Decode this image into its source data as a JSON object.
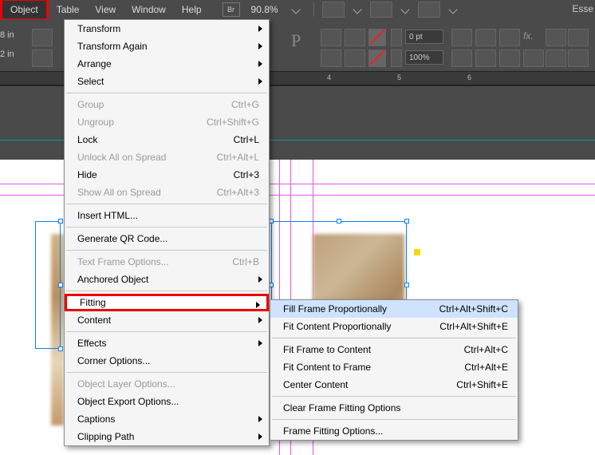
{
  "menubar": {
    "items": [
      "Object",
      "Table",
      "View",
      "Window",
      "Help"
    ],
    "active_index": 0,
    "br_label": "Br",
    "zoom": "90.8%"
  },
  "right_label": "Esse",
  "left_readouts": {
    "top": "8 in",
    "bottom": "2 in"
  },
  "toolbar2": {
    "pt_field": "0 pt",
    "pct_field": "100%"
  },
  "ruler_marks": [
    "4",
    "5",
    "6"
  ],
  "object_menu": [
    {
      "label": "Transform",
      "submenu": true
    },
    {
      "label": "Transform Again",
      "submenu": true
    },
    {
      "label": "Arrange",
      "submenu": true
    },
    {
      "label": "Select",
      "submenu": true
    },
    {
      "sep": true
    },
    {
      "label": "Group",
      "shortcut": "Ctrl+G",
      "disabled": true
    },
    {
      "label": "Ungroup",
      "shortcut": "Ctrl+Shift+G",
      "disabled": true
    },
    {
      "label": "Lock",
      "shortcut": "Ctrl+L"
    },
    {
      "label": "Unlock All on Spread",
      "shortcut": "Ctrl+Alt+L",
      "disabled": true
    },
    {
      "label": "Hide",
      "shortcut": "Ctrl+3"
    },
    {
      "label": "Show All on Spread",
      "shortcut": "Ctrl+Alt+3",
      "disabled": true
    },
    {
      "sep": true
    },
    {
      "label": "Insert HTML..."
    },
    {
      "sep": true
    },
    {
      "label": "Generate QR Code..."
    },
    {
      "sep": true
    },
    {
      "label": "Text Frame Options...",
      "shortcut": "Ctrl+B",
      "disabled": true
    },
    {
      "label": "Anchored Object",
      "submenu": true
    },
    {
      "sep": true
    },
    {
      "label": "Fitting",
      "submenu": true,
      "highlight": true,
      "boxed": true
    },
    {
      "label": "Content",
      "submenu": true
    },
    {
      "sep": true
    },
    {
      "label": "Effects",
      "submenu": true
    },
    {
      "label": "Corner Options..."
    },
    {
      "sep": true
    },
    {
      "label": "Object Layer Options...",
      "disabled": true
    },
    {
      "label": "Object Export Options..."
    },
    {
      "label": "Captions",
      "submenu": true
    },
    {
      "label": "Clipping Path",
      "submenu": true
    }
  ],
  "fitting_submenu": [
    {
      "label": "Fill Frame Proportionally",
      "shortcut": "Ctrl+Alt+Shift+C",
      "selected": true
    },
    {
      "label": "Fit Content Proportionally",
      "shortcut": "Ctrl+Alt+Shift+E"
    },
    {
      "sep": true
    },
    {
      "label": "Fit Frame to Content",
      "shortcut": "Ctrl+Alt+C"
    },
    {
      "label": "Fit Content to Frame",
      "shortcut": "Ctrl+Alt+E"
    },
    {
      "label": "Center Content",
      "shortcut": "Ctrl+Shift+E"
    },
    {
      "sep": true
    },
    {
      "label": "Clear Frame Fitting Options"
    },
    {
      "sep": true
    },
    {
      "label": "Frame Fitting Options..."
    }
  ]
}
